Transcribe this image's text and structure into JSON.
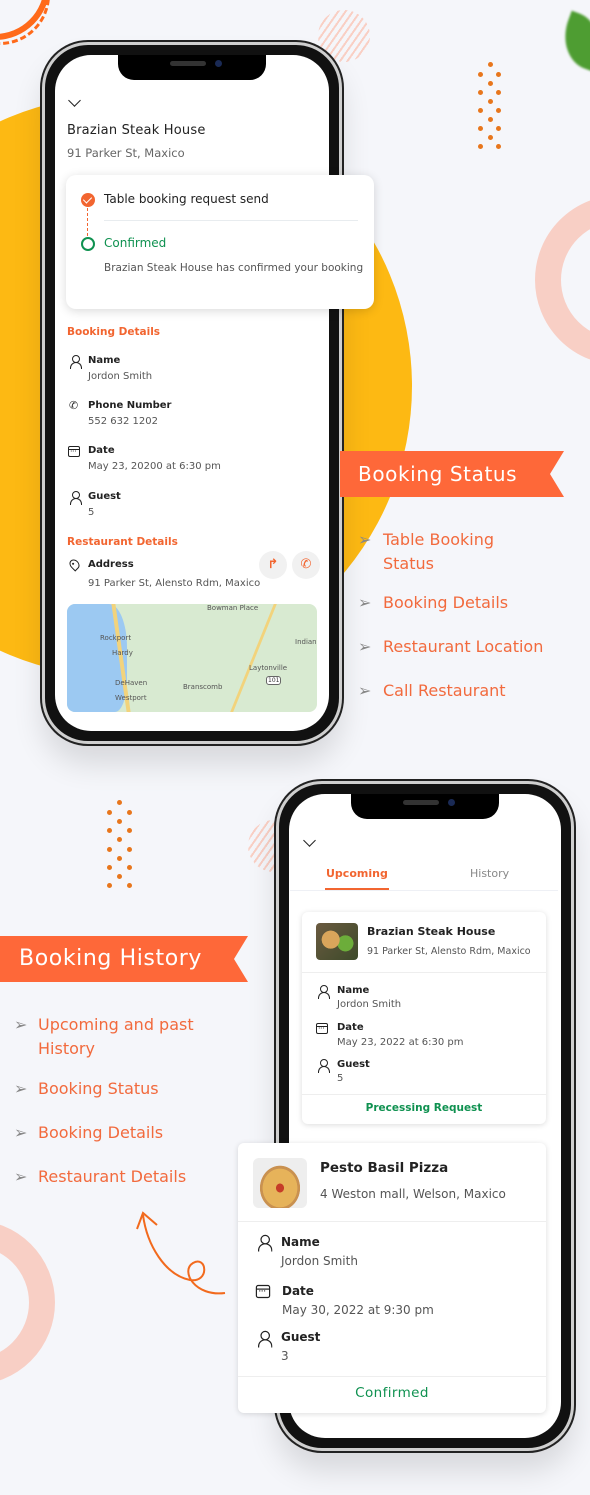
{
  "booking_status_screen": {
    "restaurant_name": "Brazian Steak House",
    "restaurant_short_address": "91 Parker St, Maxico",
    "timeline": [
      {
        "title": "Table booking request send",
        "state": "done"
      },
      {
        "title": "Confirmed",
        "description": "Brazian Steak House has confirmed your booking",
        "state": "current"
      }
    ],
    "booking_details": {
      "heading": "Booking Details",
      "fields": [
        {
          "icon": "person-icon",
          "label": "Name",
          "value": "Jordon Smith"
        },
        {
          "icon": "phone-icon",
          "label": "Phone Number",
          "value": "552 632 1202"
        },
        {
          "icon": "calendar-icon",
          "label": "Date",
          "value": "May 23, 20200 at 6:30 pm"
        },
        {
          "icon": "person-icon",
          "label": "Guest",
          "value": "5"
        }
      ]
    },
    "restaurant_details": {
      "heading": "Restaurant Details",
      "address_label": "Address",
      "address_value": "91 Parker St, Alensto Rdm, Maxico",
      "actions": [
        {
          "icon": "directions-icon",
          "glyph": "↱"
        },
        {
          "icon": "call-icon",
          "glyph": "✆"
        }
      ],
      "map_labels": [
        "Bowman Place",
        "Rockport",
        "Hardy",
        "Laytonville",
        "Indian",
        "DeHaven",
        "Branscomb",
        "Westport"
      ],
      "map_highway": "101"
    }
  },
  "booking_status_promo": {
    "banner": "Booking Status",
    "arrow_glyph": "➢",
    "features": [
      "Table Booking",
      "Status",
      "Booking Details",
      "Restaurant Location",
      "Call Restaurant"
    ]
  },
  "booking_history_promo": {
    "banner": "Booking History",
    "arrow_glyph": "➢",
    "features": [
      "Upcoming and past",
      "History",
      "Booking Status",
      "Booking Details",
      "Restaurant Details"
    ]
  },
  "booking_history_screen": {
    "tabs": [
      {
        "label": "Upcoming",
        "active": true
      },
      {
        "label": "History",
        "active": false
      }
    ],
    "bookings": [
      {
        "restaurant_name": "Brazian Steak House",
        "address": "91 Parker St, Alensto Rdm, Maxico",
        "name_label": "Name",
        "name_value": "Jordon Smith",
        "date_label": "Date",
        "date_value": "May 23, 2022 at 6:30 pm",
        "guest_label": "Guest",
        "guest_value": "5",
        "status": "Precessing Request"
      },
      {
        "restaurant_name": "Pesto Basil Pizza",
        "address": "4 Weston mall, Welson, Maxico",
        "name_label": "Name",
        "name_value": "Jordon Smith",
        "date_label": "Date",
        "date_value": "May 30, 2022 at 9:30 pm",
        "guest_label": "Guest",
        "guest_value": "3",
        "status": "Confirmed"
      }
    ]
  },
  "colors": {
    "accent": "#f26530",
    "banner": "#fe6839",
    "success": "#0f9150",
    "yellow": "#fdb913",
    "background": "#f5f6fa"
  }
}
